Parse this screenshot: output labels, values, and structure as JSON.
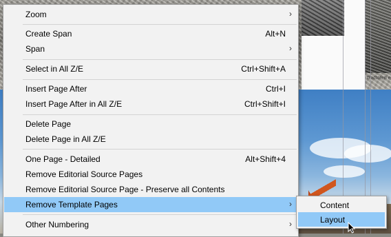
{
  "background": {
    "caption": "Tractoren en"
  },
  "menu": {
    "items": [
      {
        "label": "Zoom",
        "shortcut": "",
        "arrow": "›"
      },
      {
        "label": "Create Span",
        "shortcut": "Alt+N",
        "arrow": ""
      },
      {
        "label": "Span",
        "shortcut": "",
        "arrow": "›"
      },
      {
        "label": "Select in All Z/E",
        "shortcut": "Ctrl+Shift+A",
        "arrow": ""
      },
      {
        "label": "Insert Page After",
        "shortcut": "Ctrl+I",
        "arrow": ""
      },
      {
        "label": "Insert Page After in All Z/E",
        "shortcut": "Ctrl+Shift+I",
        "arrow": ""
      },
      {
        "label": "Delete Page",
        "shortcut": "",
        "arrow": ""
      },
      {
        "label": "Delete Page in All Z/E",
        "shortcut": "",
        "arrow": ""
      },
      {
        "label": "One Page - Detailed",
        "shortcut": "Alt+Shift+4",
        "arrow": ""
      },
      {
        "label": "Remove Editorial Source Pages",
        "shortcut": "",
        "arrow": ""
      },
      {
        "label": "Remove Editorial Source Page - Preserve all Contents",
        "shortcut": "",
        "arrow": ""
      },
      {
        "label": "Remove Template Pages",
        "shortcut": "",
        "arrow": "›"
      },
      {
        "label": "Other Numbering",
        "shortcut": "",
        "arrow": "›"
      }
    ],
    "highlighted": "Remove Template Pages"
  },
  "submenu": {
    "items": [
      {
        "label": "Content"
      },
      {
        "label": "Layout"
      }
    ],
    "highlighted": "Layout"
  },
  "colors": {
    "menu_bg": "#f2f2f2",
    "highlight": "#91c9f7",
    "separator": "#d3d3d3"
  }
}
